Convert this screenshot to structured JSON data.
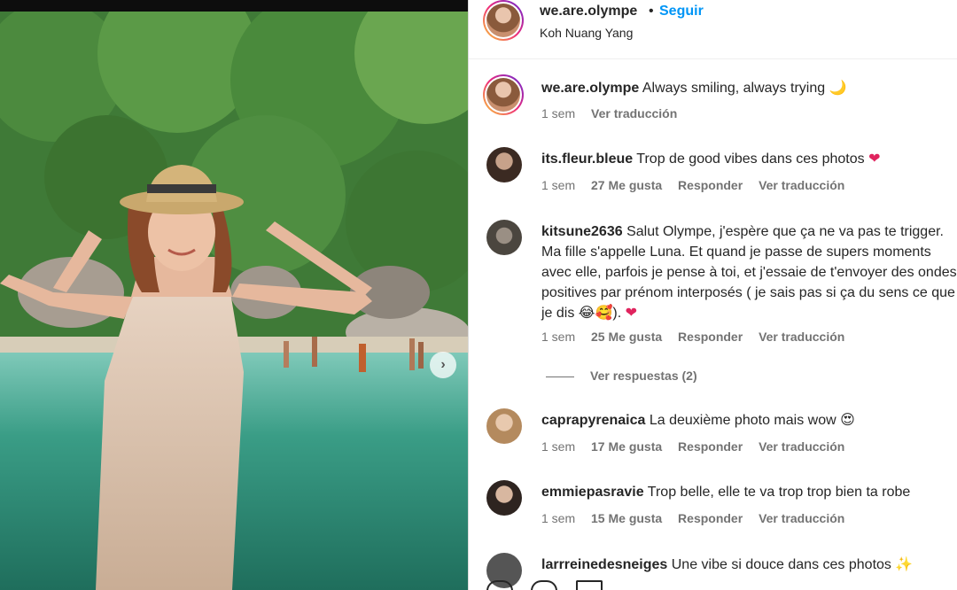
{
  "post": {
    "username": "we.are.olympe",
    "follow_label": "Seguir",
    "separator": "•",
    "location": "Koh Nuang Yang",
    "caption": "Always smiling, always trying 🌙",
    "caption_time": "1 sem",
    "translate_label": "Ver traducción"
  },
  "comments": [
    {
      "username": "its.fleur.bleue",
      "text": "Trop de good vibes dans ces photos",
      "emoji": "❤",
      "time": "1 sem",
      "likes": "27 Me gusta",
      "reply_label": "Responder",
      "translate_label": "Ver traducción"
    },
    {
      "username": "kitsune2636",
      "text": "Salut Olympe, j'espère que ça ne va pas te trigger. Ma fille s'appelle Luna. Et quand je passe de supers moments avec elle, parfois je pense à toi, et j'essaie de t'envoyer des ondes positives par prénom interposés ( je sais pas si ça du sens ce que je dis 😂🥰).",
      "emoji": "❤",
      "time": "1 sem",
      "likes": "25 Me gusta",
      "reply_label": "Responder",
      "translate_label": "Ver traducción",
      "view_replies": "Ver respuestas (2)"
    },
    {
      "username": "caprapyrenaica",
      "text": "La deuxième photo mais wow 😍",
      "time": "1 sem",
      "likes": "17 Me gusta",
      "reply_label": "Responder",
      "translate_label": "Ver traducción"
    },
    {
      "username": "emmiepasravie",
      "text": "Trop belle, elle te va trop trop bien ta robe",
      "time": "1 sem",
      "likes": "15 Me gusta",
      "reply_label": "Responder",
      "translate_label": "Ver traducción"
    },
    {
      "username": "larrreinedesneiges",
      "text": "Une vibe si douce dans ces photos ✨"
    }
  ],
  "icons": {
    "next": "chevron-right-icon",
    "like": "heart-icon",
    "comment": "comment-icon",
    "share": "share-icon"
  },
  "colors": {
    "follow_blue": "#0095f6",
    "heart_red": "#e0245e",
    "meta_gray": "#737373"
  }
}
